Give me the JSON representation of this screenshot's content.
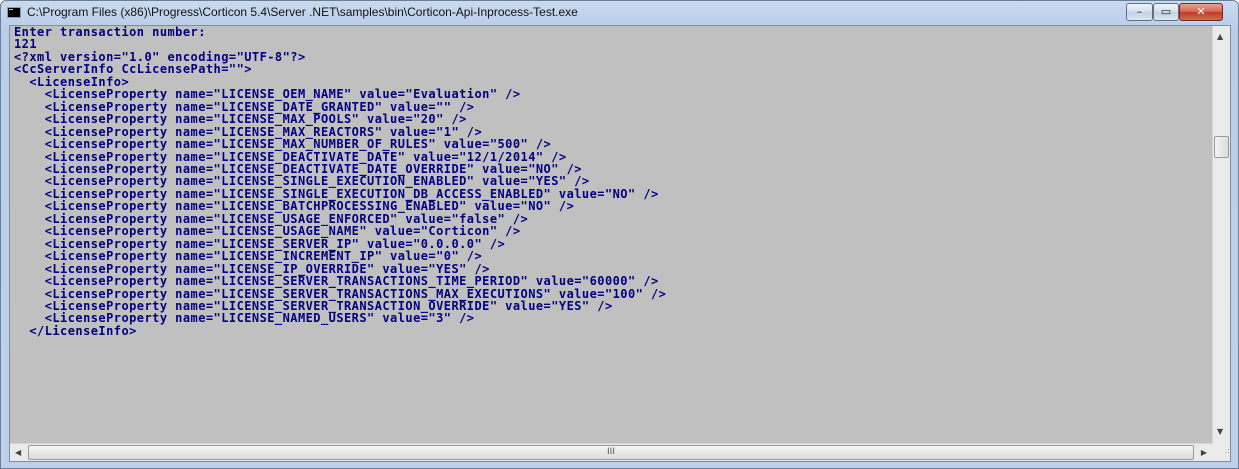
{
  "window": {
    "title": "C:\\Program Files (x86)\\Progress\\Corticon 5.4\\Server .NET\\samples\\bin\\Corticon-Api-Inprocess-Test.exe",
    "controls": {
      "minimize": "–",
      "maximize": "▭",
      "close": "✕"
    }
  },
  "console": {
    "lines": [
      "Enter transaction number:",
      "121",
      "<?xml version=\"1.0\" encoding=\"UTF-8\"?>",
      "<CcServerInfo CcLicensePath=\"\">",
      "  <LicenseInfo>",
      "    <LicenseProperty name=\"LICENSE_OEM_NAME\" value=\"Evaluation\" />",
      "    <LicenseProperty name=\"LICENSE_DATE_GRANTED\" value=\"\" />",
      "    <LicenseProperty name=\"LICENSE_MAX_POOLS\" value=\"20\" />",
      "    <LicenseProperty name=\"LICENSE_MAX_REACTORS\" value=\"1\" />",
      "    <LicenseProperty name=\"LICENSE_MAX_NUMBER_OF_RULES\" value=\"500\" />",
      "    <LicenseProperty name=\"LICENSE_DEACTIVATE_DATE\" value=\"12/1/2014\" />",
      "    <LicenseProperty name=\"LICENSE_DEACTIVATE_DATE_OVERRIDE\" value=\"NO\" />",
      "    <LicenseProperty name=\"LICENSE_SINGLE_EXECUTION_ENABLED\" value=\"YES\" />",
      "    <LicenseProperty name=\"LICENSE_SINGLE_EXECUTION_DB_ACCESS_ENABLED\" value=\"NO\" />",
      "    <LicenseProperty name=\"LICENSE_BATCHPROCESSING_ENABLED\" value=\"NO\" />",
      "    <LicenseProperty name=\"LICENSE_USAGE_ENFORCED\" value=\"false\" />",
      "    <LicenseProperty name=\"LICENSE_USAGE_NAME\" value=\"Corticon\" />",
      "    <LicenseProperty name=\"LICENSE_SERVER_IP\" value=\"0.0.0.0\" />",
      "    <LicenseProperty name=\"LICENSE_INCREMENT_IP\" value=\"0\" />",
      "    <LicenseProperty name=\"LICENSE_IP_OVERRIDE\" value=\"YES\" />",
      "    <LicenseProperty name=\"LICENSE_SERVER_TRANSACTIONS_TIME_PERIOD\" value=\"60000\" />",
      "    <LicenseProperty name=\"LICENSE_SERVER_TRANSACTIONS_MAX_EXECUTIONS\" value=\"100\" />",
      "    <LicenseProperty name=\"LICENSE_SERVER_TRANSACTION_OVERRIDE\" value=\"YES\" />",
      "    <LicenseProperty name=\"LICENSE_NAMED_USERS\" value=\"3\" />",
      "  </LicenseInfo>"
    ]
  },
  "scrollbar": {
    "up_arrow": "▲",
    "down_arrow": "▼",
    "left_arrow": "◀",
    "right_arrow": "▶",
    "h_grip": "III",
    "resize_grip": ".:"
  },
  "colors": {
    "console_bg": "#c0c0c0",
    "console_text": "#000080",
    "close_button": "#c74b34"
  }
}
